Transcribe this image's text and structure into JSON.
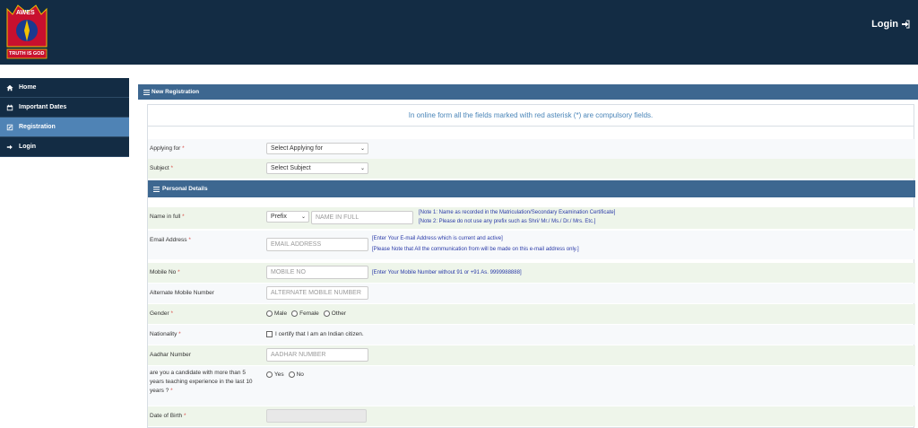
{
  "header": {
    "logo_top_text": "AWES",
    "logo_bottom_text": "TRUTH IS GOD",
    "login_label": "Login"
  },
  "sidebar": {
    "items": [
      {
        "label": "Home",
        "icon": "home-icon"
      },
      {
        "label": "Important Dates",
        "icon": "calendar-icon"
      },
      {
        "label": "Registration",
        "icon": "edit-icon"
      },
      {
        "label": "Login",
        "icon": "login-icon"
      }
    ]
  },
  "main": {
    "panel_title": "New Registration",
    "notice": "In online form all the fields marked with red asterisk (*) are compulsory fields.",
    "applying_for": {
      "label": "Applying for",
      "required": "*",
      "value": "Select Applying for"
    },
    "subject": {
      "label": "Subject",
      "required": "*",
      "value": "Select Subject"
    },
    "personal_title": "Personal Details",
    "name": {
      "label": "Name in full",
      "required": "*",
      "prefix": "Prefix",
      "placeholder": "NAME IN FULL",
      "note1": "[Note 1: Name as recorded in the Matriculation/Secondary Examination Certificate]",
      "note2": "[Note 2: Please do not use any prefix such as Shri/ Mr./ Ms./ Dr./ Mrs. Etc.]"
    },
    "email": {
      "label": "Email Address",
      "required": "*",
      "placeholder": "EMAIL ADDRESS",
      "note1": "[Enter Your E-mail Address which is current and active]",
      "note2": "[Please Note that All the communication from will be made on this e-mail address only.]"
    },
    "mobile": {
      "label": "Mobile No",
      "required": "*",
      "placeholder": "MOBILE NO",
      "note": "[Enter Your Mobile Number without 91 or +91 As. 9999988888]"
    },
    "alt_mobile": {
      "label": "Alternate Mobile Number",
      "placeholder": "ALTERNATE MOBILE NUMBER"
    },
    "gender": {
      "label": "Gender",
      "required": "*",
      "options": [
        "Male",
        "Female",
        "Other"
      ]
    },
    "nationality": {
      "label": "Nationality",
      "required": "*",
      "checkbox_label": "I certify that I am an Indian citizen."
    },
    "aadhar": {
      "label": "Aadhar Number",
      "placeholder": "AADHAR NUMBER"
    },
    "teaching": {
      "label_line1": "are you a candidate with more than 5",
      "label_line2": "years teaching experience in the last 10",
      "label_line3": "years ?",
      "required": "*",
      "options": [
        "Yes",
        "No"
      ]
    },
    "dob": {
      "label": "Date of Birth",
      "required": "*"
    }
  },
  "colors": {
    "header_bg": "#132c44",
    "sidebar_active": "#4f83b5",
    "section_bar": "#3d6790",
    "required": "#d9534f",
    "note_text": "#2a3aa8"
  }
}
